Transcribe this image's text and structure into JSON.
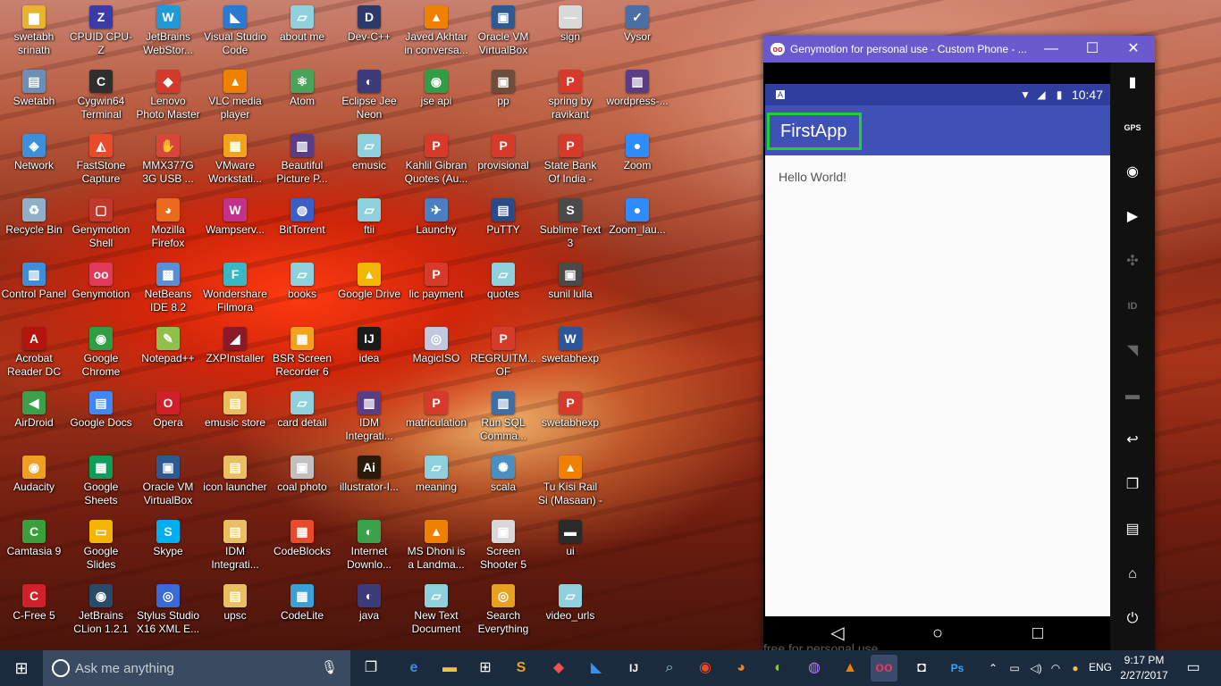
{
  "desktop_icons": [
    {
      "label": "swetabh srinath",
      "glyph": "▆",
      "color": "#e8b330"
    },
    {
      "label": "CPUID CPU-Z",
      "glyph": "Z",
      "color": "#3a3aa8"
    },
    {
      "label": "JetBrains WebStor...",
      "glyph": "W",
      "color": "#1f9ad6"
    },
    {
      "label": "Visual Studio Code",
      "glyph": "◣",
      "color": "#2a7ad1"
    },
    {
      "label": "about me",
      "glyph": "▱",
      "color": "#8fd0de"
    },
    {
      "label": "Dev-C++",
      "glyph": "D",
      "color": "#2b3a6b"
    },
    {
      "label": "Javed Akhtar in conversa...",
      "glyph": "▲",
      "color": "#f08000"
    },
    {
      "label": "Oracle VM VirtualBox",
      "glyph": "▣",
      "color": "#2e5a94"
    },
    {
      "label": "sign",
      "glyph": "—",
      "color": "#d9d9d9"
    },
    {
      "label": "Vysor",
      "glyph": "✓",
      "color": "#4a6fa5"
    },
    {
      "label": "Swetabh",
      "glyph": "▤",
      "color": "#6d8fb5"
    },
    {
      "label": "Cygwin64 Terminal",
      "glyph": "C",
      "color": "#2f2f2f"
    },
    {
      "label": "Lenovo Photo Master",
      "glyph": "◆",
      "color": "#d23b2b"
    },
    {
      "label": "VLC media player",
      "glyph": "▲",
      "color": "#f08000"
    },
    {
      "label": "Atom",
      "glyph": "⚛",
      "color": "#4aa35a"
    },
    {
      "label": "Eclipse Jee Neon",
      "glyph": "◐",
      "color": "#3b3a7a"
    },
    {
      "label": "jse api",
      "glyph": "◉",
      "color": "#2f9e44"
    },
    {
      "label": "pp",
      "glyph": "▣",
      "color": "#6d4d3b"
    },
    {
      "label": "spring by ravikant",
      "glyph": "P",
      "color": "#d63a2a"
    },
    {
      "label": "wordpress-...",
      "glyph": "▥",
      "color": "#5a3d87"
    },
    {
      "label": "Network",
      "glyph": "◈",
      "color": "#3c8fd8"
    },
    {
      "label": "FastStone Capture",
      "glyph": "◭",
      "color": "#e84a2a"
    },
    {
      "label": "MMX377G 3G USB ...",
      "glyph": "✋",
      "color": "#d8453a"
    },
    {
      "label": "VMware Workstati...",
      "glyph": "▦",
      "color": "#f2a31b"
    },
    {
      "label": "Beautiful Picture P...",
      "glyph": "▥",
      "color": "#5a3d87"
    },
    {
      "label": "emusic",
      "glyph": "▱",
      "color": "#8fd0de"
    },
    {
      "label": "Kahlil Gibran Quotes (Au...",
      "glyph": "P",
      "color": "#d63a2a"
    },
    {
      "label": "provisional",
      "glyph": "P",
      "color": "#d63a2a"
    },
    {
      "label": "State Bank Of India -Recr...",
      "glyph": "P",
      "color": "#d63a2a"
    },
    {
      "label": "Zoom",
      "glyph": "●",
      "color": "#2d8cff"
    },
    {
      "label": "Recycle Bin",
      "glyph": "♻",
      "color": "#8fb0c8"
    },
    {
      "label": "Genymotion Shell",
      "glyph": "▢",
      "color": "#c0392b"
    },
    {
      "label": "Mozilla Firefox",
      "glyph": "◕",
      "color": "#e86a1a"
    },
    {
      "label": "Wampserv...",
      "glyph": "W",
      "color": "#c2328a"
    },
    {
      "label": "BitTorrent",
      "glyph": "◍",
      "color": "#3b5fc7"
    },
    {
      "label": "ftii",
      "glyph": "▱",
      "color": "#8fd0de"
    },
    {
      "label": "Launchy",
      "glyph": "✈",
      "color": "#4a7fc1"
    },
    {
      "label": "PuTTY",
      "glyph": "▤",
      "color": "#2a4a8a"
    },
    {
      "label": "Sublime Text 3",
      "glyph": "S",
      "color": "#4a4a4a"
    },
    {
      "label": "Zoom_lau...",
      "glyph": "●",
      "color": "#2d8cff"
    },
    {
      "label": "Control Panel",
      "glyph": "▥",
      "color": "#3c8fd8"
    },
    {
      "label": "Genymotion",
      "glyph": "oo",
      "color": "#e03a5a"
    },
    {
      "label": "NetBeans IDE 8.2",
      "glyph": "▩",
      "color": "#5a8fd6"
    },
    {
      "label": "Wondershare Filmora",
      "glyph": "F",
      "color": "#37b8c2"
    },
    {
      "label": "books",
      "glyph": "▱",
      "color": "#8fd0de"
    },
    {
      "label": "Google Drive",
      "glyph": "▲",
      "color": "#f2b705"
    },
    {
      "label": "lic payment",
      "glyph": "P",
      "color": "#d63a2a"
    },
    {
      "label": "quotes",
      "glyph": "▱",
      "color": "#8fd0de"
    },
    {
      "label": "sunil lulla",
      "glyph": "▣",
      "color": "#4a4a4a"
    },
    {
      "label": "Acrobat Reader DC",
      "glyph": "A",
      "color": "#b3150e"
    },
    {
      "label": "Google Chrome",
      "glyph": "◉",
      "color": "#2f9e44"
    },
    {
      "label": "Notepad++",
      "glyph": "✎",
      "color": "#8fc04a"
    },
    {
      "label": "ZXPInstaller",
      "glyph": "◢",
      "color": "#8a1a2a"
    },
    {
      "label": "BSR Screen Recorder 6",
      "glyph": "▦",
      "color": "#f2a31b"
    },
    {
      "label": "idea",
      "glyph": "IJ",
      "color": "#1a1a1a"
    },
    {
      "label": "MagicISO",
      "glyph": "◎",
      "color": "#c0c8e0"
    },
    {
      "label": "REGRUITM... OF PROBAT...",
      "glyph": "P",
      "color": "#d63a2a"
    },
    {
      "label": "swetabhexp",
      "glyph": "W",
      "color": "#2b579a"
    },
    {
      "label": "AirDroid",
      "glyph": "◀",
      "color": "#3aa04a"
    },
    {
      "label": "Google Docs",
      "glyph": "▤",
      "color": "#4285f4"
    },
    {
      "label": "Opera",
      "glyph": "O",
      "color": "#d0202a"
    },
    {
      "label": "emusic store",
      "glyph": "▤",
      "color": "#e8c060"
    },
    {
      "label": "card detail",
      "glyph": "▱",
      "color": "#8fd0de"
    },
    {
      "label": "IDM Integrati...",
      "glyph": "▥",
      "color": "#5a3d87"
    },
    {
      "label": "matriculation",
      "glyph": "P",
      "color": "#d63a2a"
    },
    {
      "label": "Run SQL Comma...",
      "glyph": "▥",
      "color": "#3c6ea8"
    },
    {
      "label": "swetabhexp",
      "glyph": "P",
      "color": "#d63a2a"
    },
    {
      "label": "Audacity",
      "glyph": "◉",
      "color": "#f0a020"
    },
    {
      "label": "Google Sheets",
      "glyph": "▦",
      "color": "#0f9d58"
    },
    {
      "label": "Oracle VM VirtualBox",
      "glyph": "▣",
      "color": "#2e5a94"
    },
    {
      "label": "icon launcher",
      "glyph": "▤",
      "color": "#e8c060"
    },
    {
      "label": "coal photo",
      "glyph": "▣",
      "color": "#c0c0c0"
    },
    {
      "label": "illustrator-I...",
      "glyph": "Ai",
      "color": "#2a1a0a"
    },
    {
      "label": "meaning",
      "glyph": "▱",
      "color": "#8fd0de"
    },
    {
      "label": "scala",
      "glyph": "✺",
      "color": "#4a8fc1"
    },
    {
      "label": "Tu Kisi Rail Si (Masaan) - ...",
      "glyph": "▲",
      "color": "#f08000"
    },
    {
      "label": "Camtasia 9",
      "glyph": "C",
      "color": "#3aa03a"
    },
    {
      "label": "Google Slides",
      "glyph": "▭",
      "color": "#f4b400"
    },
    {
      "label": "Skype",
      "glyph": "S",
      "color": "#00aff0"
    },
    {
      "label": "IDM Integrati...",
      "glyph": "▤",
      "color": "#e8c060"
    },
    {
      "label": "CodeBlocks",
      "glyph": "▦",
      "color": "#e84a2a"
    },
    {
      "label": "Internet Downlo...",
      "glyph": "◐",
      "color": "#3aa04a"
    },
    {
      "label": "MS Dhoni is a Landma...",
      "glyph": "▲",
      "color": "#f08000"
    },
    {
      "label": "Screen Shooter 5",
      "glyph": "▣",
      "color": "#d8d8d8"
    },
    {
      "label": "ui",
      "glyph": "▬",
      "color": "#2a2a2a"
    },
    {
      "label": "C-Free 5",
      "glyph": "C",
      "color": "#d0202a"
    },
    {
      "label": "JetBrains CLion 1.2.1",
      "glyph": "◉",
      "color": "#2a4a6a"
    },
    {
      "label": "Stylus Studio X16 XML E...",
      "glyph": "◎",
      "color": "#3a6ad8"
    },
    {
      "label": "upsc",
      "glyph": "▤",
      "color": "#e8c060"
    },
    {
      "label": "CodeLite",
      "glyph": "▦",
      "color": "#3aa0d8"
    },
    {
      "label": "java",
      "glyph": "◐",
      "color": "#3b3a7a"
    },
    {
      "label": "New Text Document",
      "glyph": "▱",
      "color": "#8fd0de"
    },
    {
      "label": "Search Everything",
      "glyph": "◎",
      "color": "#e8a020"
    },
    {
      "label": "video_urls",
      "glyph": "▱",
      "color": "#8fd0de"
    }
  ],
  "genymotion": {
    "window_title": "Genymotion for personal use - Custom Phone - ...",
    "minimize": "—",
    "maximize": "☐",
    "close": "✕",
    "status_clock": "10:47",
    "app_title": "FirstApp",
    "body_text": "Hello World!",
    "watermark": "free for personal use",
    "sidebar": [
      "battery-icon",
      "gps-icon",
      "camera-icon",
      "video-icon",
      "dpad-icon",
      "id-icon",
      "rss-icon",
      "sms-icon",
      "back-icon",
      "recent-apps-icon",
      "menu-icon",
      "home-icon",
      "power-icon"
    ],
    "gps_label": "GPS",
    "id_label": "ID"
  },
  "taskbar": {
    "search_placeholder": "Ask me anything",
    "apps": [
      "task-view",
      "edge",
      "file-explorer",
      "store",
      "sublime",
      "paint",
      "visual-studio-code",
      "intellij",
      "magnifier",
      "chrome",
      "firefox",
      "android-studio",
      "cat-app",
      "vlc",
      "genymotion",
      "camera",
      "photoshop"
    ],
    "language": "ENG",
    "time": "9:17 PM",
    "date": "2/27/2017"
  }
}
